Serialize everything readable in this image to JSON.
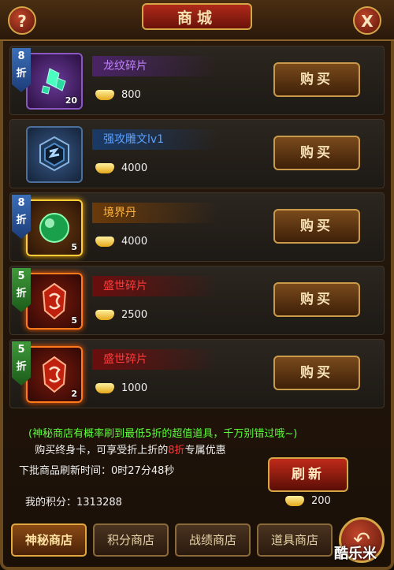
{
  "title": "商城",
  "help_label": "?",
  "close_label": "X",
  "items": [
    {
      "discount_num": "8",
      "discount_unit": "折",
      "name": "龙纹碎片",
      "quantity": "20",
      "price": "800",
      "buy_label": "购买",
      "icon": "green-crystal-fragment-icon"
    },
    {
      "name": "强攻雕文lv1",
      "price": "4000",
      "buy_label": "购买",
      "icon": "rune-glyph-icon"
    },
    {
      "discount_num": "8",
      "discount_unit": "折",
      "name": "境界丹",
      "quantity": "5",
      "price": "4000",
      "buy_label": "购买",
      "icon": "green-pill-icon"
    },
    {
      "discount_num": "5",
      "discount_unit": "折",
      "name": "盛世碎片",
      "quantity": "5",
      "price": "2500",
      "buy_label": "购买",
      "icon": "red-emblem-fragment-icon"
    },
    {
      "discount_num": "5",
      "discount_unit": "折",
      "name": "盛世碎片",
      "quantity": "2",
      "price": "1000",
      "buy_label": "购买",
      "icon": "red-emblem-fragment-icon"
    }
  ],
  "notice": {
    "line1": "(神秘商店有概率刷到最低5折的超值道具，千万别错过哦~)",
    "line2_a": "购买终身卡，可享受折上折的",
    "line2_hl": "8折",
    "line2_b": "专属优惠"
  },
  "refresh_time": "下批商品刷新时间：0时27分48秒",
  "refresh_label": "刷新",
  "refresh_cost": "200",
  "points": "我的积分：1313288",
  "tabs": [
    "神秘商店",
    "积分商店",
    "战绩商店",
    "道具商店"
  ],
  "active_tab": 0,
  "back_label": "↶",
  "watermark": "酷乐米",
  "colors": {
    "gold_border": "#d4a646",
    "name_purple": "#c080ff",
    "name_blue": "#5aa0ff",
    "name_orange": "#ffb43a",
    "name_red": "#ff3a3a",
    "notice_green": "#5aff3a",
    "badge_blue": "#3b6fb8",
    "badge_green": "#3f9a3a"
  }
}
